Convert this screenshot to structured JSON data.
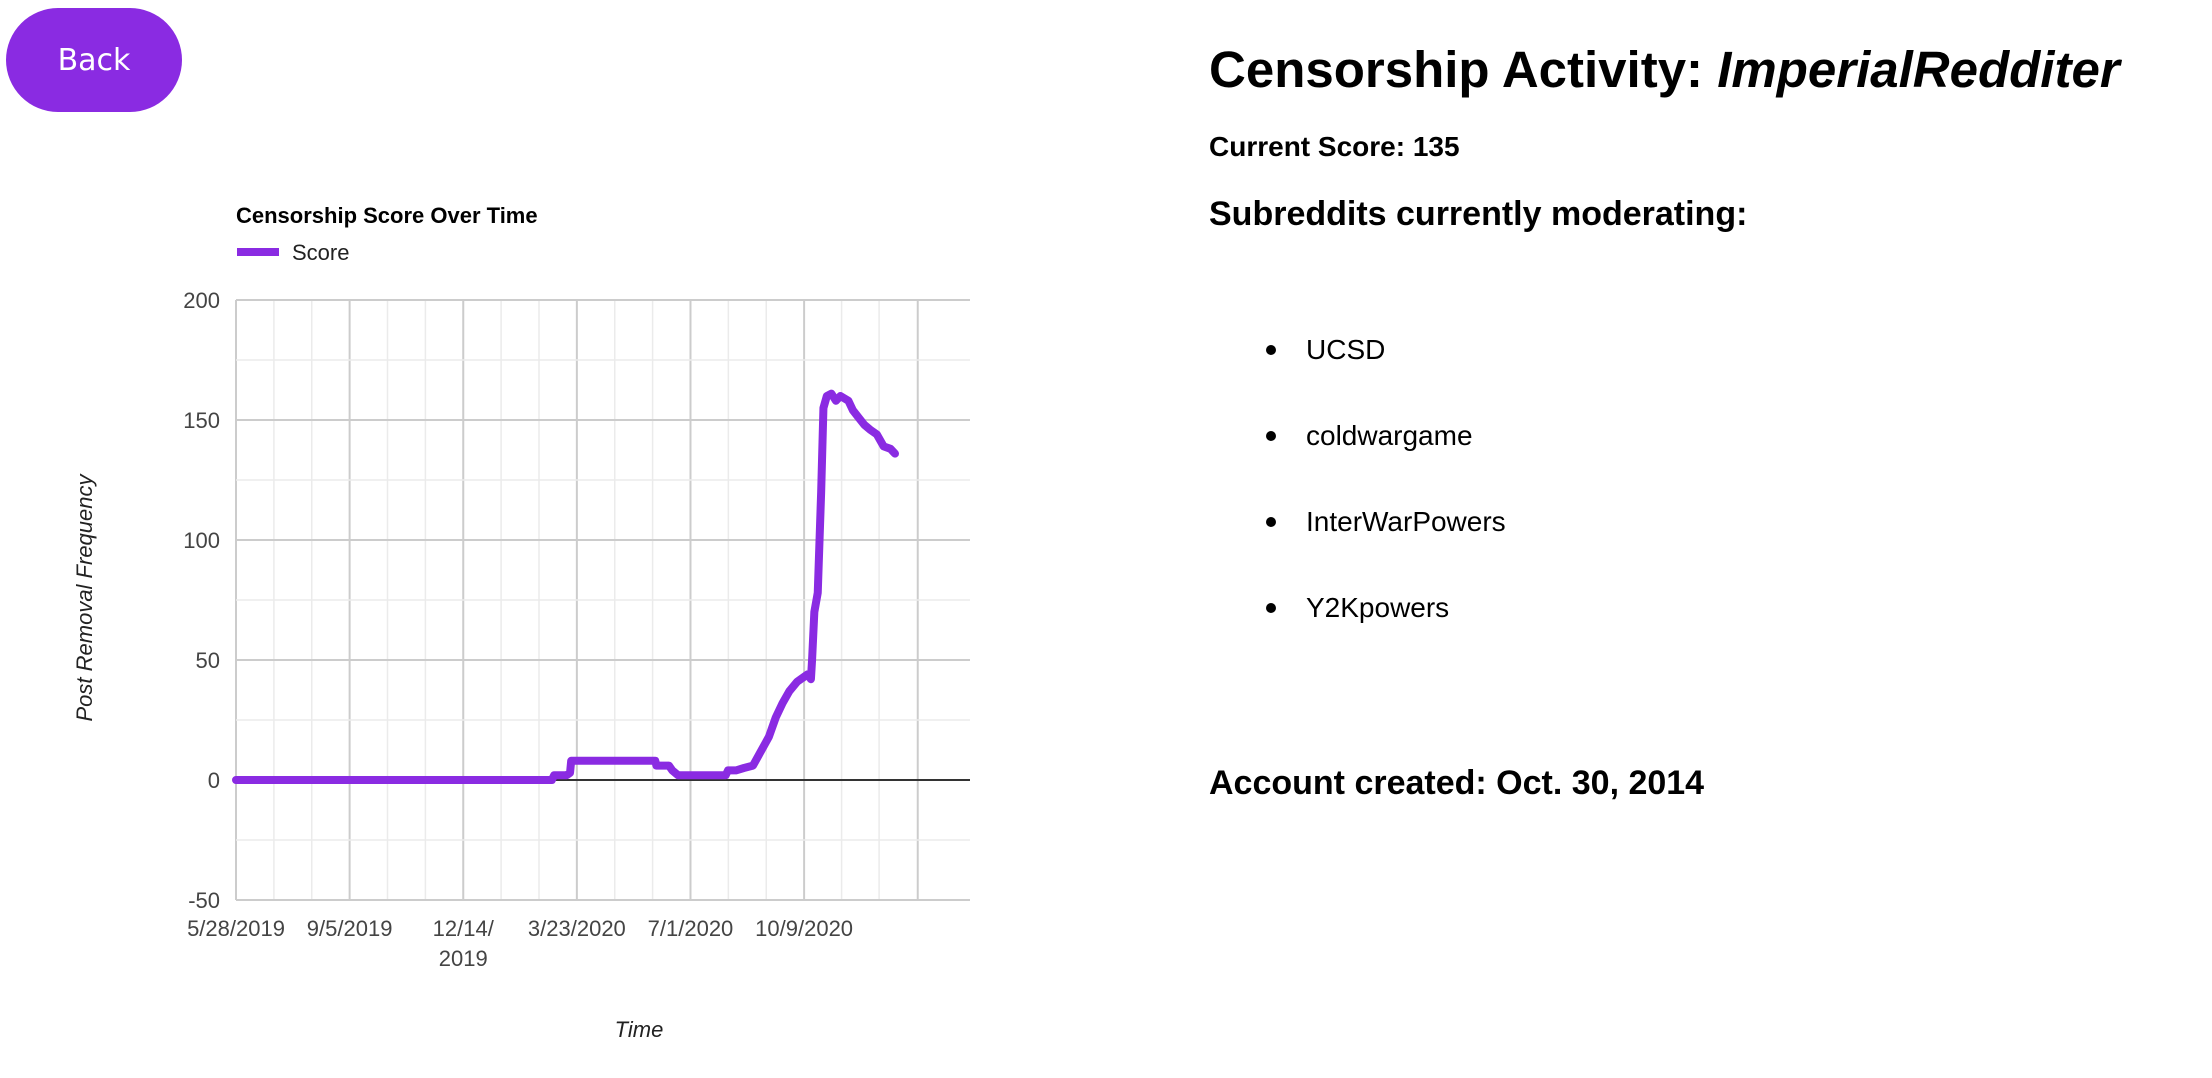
{
  "back_button": {
    "label": "Back"
  },
  "header": {
    "title_prefix": "Censorship Activity: ",
    "username": "ImperialRedditer"
  },
  "score": {
    "label": "Current Score: 135"
  },
  "moderating": {
    "heading": "Subreddits currently moderating:",
    "items": [
      "UCSD",
      "coldwargame",
      "InterWarPowers",
      "Y2Kpowers"
    ]
  },
  "account": {
    "created": "Account created: Oct. 30, 2014"
  },
  "colors": {
    "accent": "#8a2be2",
    "grid_major": "#cccccc",
    "grid_minor": "#ebebeb",
    "baseline": "#333333"
  },
  "chart_data": {
    "type": "line",
    "title": "Censorship Score Over Time",
    "xlabel": "Time",
    "ylabel": "Post Removal Frequency",
    "legend": {
      "position": "top-left",
      "entries": [
        "Score"
      ]
    },
    "grid": true,
    "ylim": [
      -50,
      200
    ],
    "yticks": [
      "200",
      "150",
      "100",
      "50",
      "0",
      "-50"
    ],
    "xlim": [
      "2019-05-28",
      "2021-03-04"
    ],
    "xticks": [
      {
        "date": "2019-05-28",
        "label": [
          "5/28/2019"
        ]
      },
      {
        "date": "2019-09-05",
        "label": [
          "9/5/2019"
        ]
      },
      {
        "date": "2019-12-14",
        "label": [
          "12/14/",
          "2019"
        ]
      },
      {
        "date": "2020-03-23",
        "label": [
          "3/23/2020"
        ]
      },
      {
        "date": "2020-07-01",
        "label": [
          "7/1/2020"
        ]
      },
      {
        "date": "2020-10-09",
        "label": [
          "10/9/2020"
        ]
      }
    ],
    "series": [
      {
        "name": "Score",
        "points": [
          [
            "2019-05-28",
            0
          ],
          [
            "2019-08-01",
            0
          ],
          [
            "2019-10-15",
            0
          ],
          [
            "2019-12-14",
            0
          ],
          [
            "2020-02-20",
            0
          ],
          [
            "2020-03-01",
            0
          ],
          [
            "2020-03-03",
            2
          ],
          [
            "2020-03-14",
            2
          ],
          [
            "2020-03-17",
            3
          ],
          [
            "2020-03-18",
            8
          ],
          [
            "2020-04-01",
            8
          ],
          [
            "2020-04-20",
            8
          ],
          [
            "2020-05-05",
            8
          ],
          [
            "2020-05-31",
            8
          ],
          [
            "2020-06-01",
            6
          ],
          [
            "2020-06-12",
            6
          ],
          [
            "2020-06-15",
            4
          ],
          [
            "2020-06-20",
            2
          ],
          [
            "2020-07-01",
            2
          ],
          [
            "2020-07-20",
            2
          ],
          [
            "2020-08-01",
            2
          ],
          [
            "2020-08-03",
            4
          ],
          [
            "2020-08-10",
            4
          ],
          [
            "2020-08-17",
            5
          ],
          [
            "2020-08-25",
            6
          ],
          [
            "2020-09-01",
            12
          ],
          [
            "2020-09-08",
            18
          ],
          [
            "2020-09-14",
            26
          ],
          [
            "2020-09-20",
            32
          ],
          [
            "2020-09-26",
            37
          ],
          [
            "2020-10-03",
            41
          ],
          [
            "2020-10-09",
            43
          ],
          [
            "2020-10-12",
            44
          ],
          [
            "2020-10-15",
            42
          ],
          [
            "2020-10-16",
            50
          ],
          [
            "2020-10-18",
            70
          ],
          [
            "2020-10-21",
            78
          ],
          [
            "2020-10-24",
            120
          ],
          [
            "2020-10-26",
            155
          ],
          [
            "2020-10-29",
            160
          ],
          [
            "2020-11-02",
            161
          ],
          [
            "2020-11-06",
            158
          ],
          [
            "2020-11-10",
            160
          ],
          [
            "2020-11-17",
            158
          ],
          [
            "2020-11-21",
            154
          ],
          [
            "2020-11-26",
            151
          ],
          [
            "2020-12-01",
            148
          ],
          [
            "2020-12-06",
            146
          ],
          [
            "2020-12-12",
            144
          ],
          [
            "2020-12-18",
            139
          ],
          [
            "2020-12-24",
            138
          ],
          [
            "2020-12-28",
            136
          ]
        ]
      }
    ]
  }
}
